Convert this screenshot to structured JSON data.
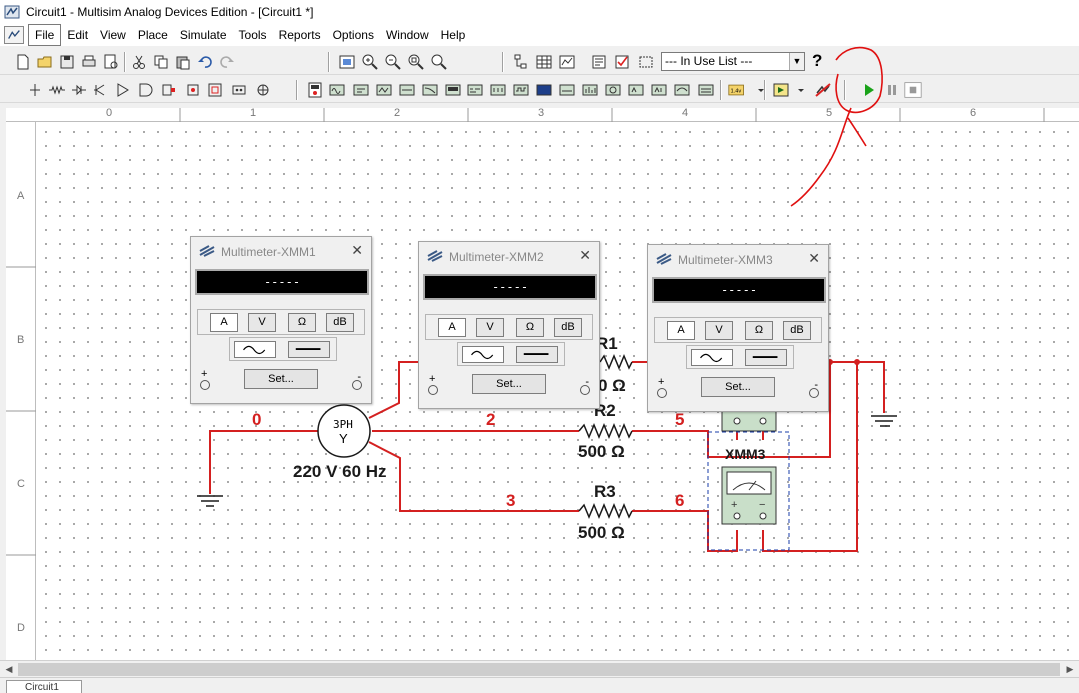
{
  "window": {
    "title": "Circuit1 - Multisim Analog Devices Edition - [Circuit1 *]"
  },
  "menu": [
    "File",
    "Edit",
    "View",
    "Place",
    "Simulate",
    "Tools",
    "Reports",
    "Options",
    "Window",
    "Help"
  ],
  "toolbar": {
    "in_use_list": "--- In Use List ---",
    "help_label": "?"
  },
  "rulers": {
    "rows": [
      "A",
      "B",
      "C",
      "D"
    ],
    "cols": [
      "0",
      "1",
      "2",
      "3",
      "4",
      "5",
      "6"
    ]
  },
  "multimeters": [
    {
      "title": "Multimeter-XMM1",
      "display": "-----",
      "buttons": [
        "A",
        "V",
        "Ω",
        "dB"
      ],
      "set_label": "Set...",
      "plus": "+",
      "minus": "-"
    },
    {
      "title": "Multimeter-XMM2",
      "display": "-----",
      "buttons": [
        "A",
        "V",
        "Ω",
        "dB"
      ],
      "set_label": "Set...",
      "plus": "+",
      "minus": "-"
    },
    {
      "title": "Multimeter-XMM3",
      "display": "-----",
      "buttons": [
        "A",
        "V",
        "Ω",
        "dB"
      ],
      "set_label": "Set...",
      "plus": "+",
      "minus": "-"
    }
  ],
  "circuit": {
    "source": {
      "symbol_top": "3PH",
      "symbol_bottom": "Y",
      "rating": "220 V 60 Hz"
    },
    "nets": [
      "0",
      "2",
      "3",
      "5",
      "6"
    ],
    "resistors": [
      {
        "name": "R1",
        "value": "0 Ω"
      },
      {
        "name": "R2",
        "value": "500 Ω"
      },
      {
        "name": "R3",
        "value": "500 Ω"
      }
    ],
    "meter_label": "XMM3"
  },
  "colors": {
    "wire": "#d42020",
    "annotation": "#e01010",
    "meter_body": "#c9dfc9",
    "play": "#1aa31a"
  },
  "status_tab": "Circuit1"
}
